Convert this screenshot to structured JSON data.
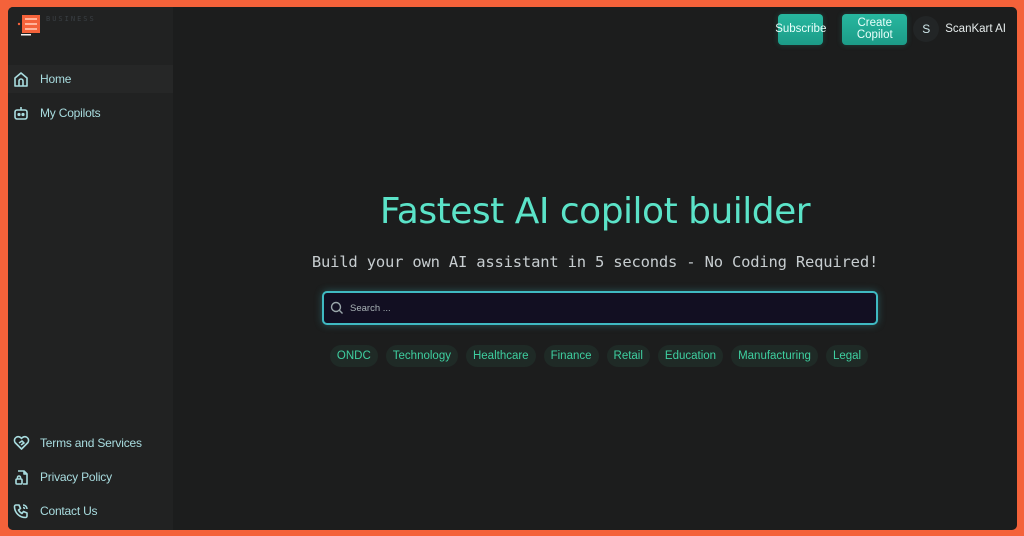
{
  "brand": {
    "logo_text": "BUSINESS",
    "logo_color": "#f4623a"
  },
  "sidebar": {
    "top_items": [
      {
        "label": "Home",
        "icon": "home-icon"
      },
      {
        "label": "My Copilots",
        "icon": "robot-icon"
      }
    ],
    "bottom_items": [
      {
        "label": "Terms and Services",
        "icon": "heart-handshake-icon"
      },
      {
        "label": "Privacy Policy",
        "icon": "file-lock-icon"
      },
      {
        "label": "Contact Us",
        "icon": "phone-call-icon"
      }
    ]
  },
  "header": {
    "subscribe_label": "Subscribe",
    "create_copilot_label": "Create Copilot",
    "avatar_initial": "S",
    "user_name": "ScanKart AI"
  },
  "hero": {
    "title": "Fastest AI copilot builder",
    "subtitle": "Build your own AI assistant in 5 seconds - No Coding Required!"
  },
  "search": {
    "placeholder": "Search ...",
    "value": ""
  },
  "categories": [
    "ONDC",
    "Technology",
    "Healthcare",
    "Finance",
    "Retail",
    "Education",
    "Manufacturing",
    "Legal"
  ],
  "colors": {
    "accent": "#5be3c8",
    "button": "#1fa990",
    "frame": "#f4623a",
    "chip_text": "#3ecfa0"
  }
}
